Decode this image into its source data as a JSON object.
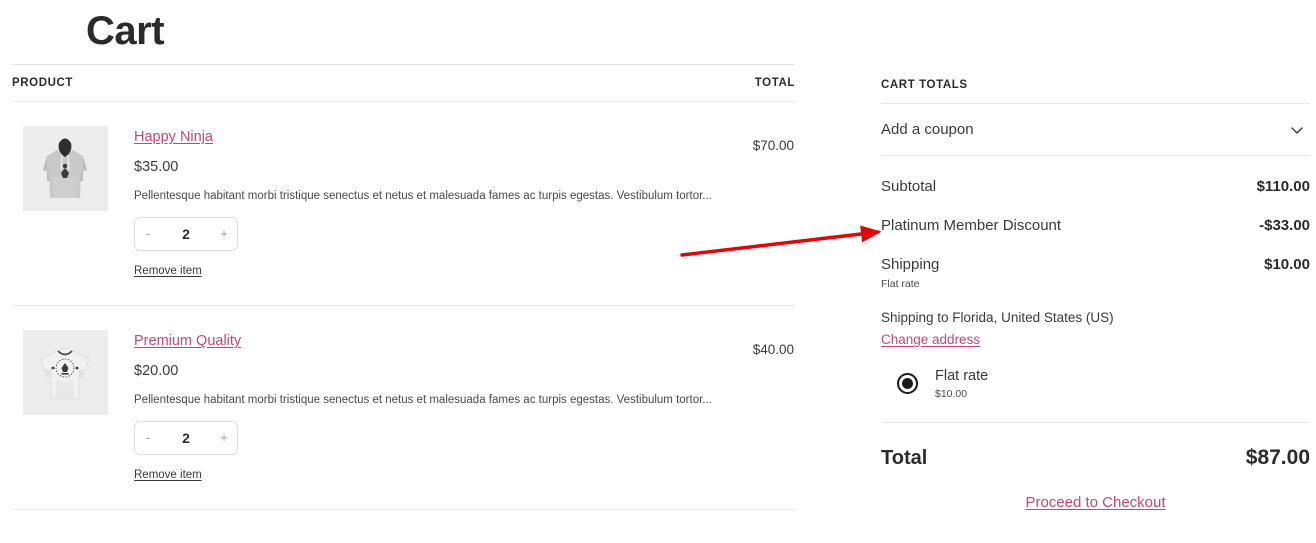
{
  "page": {
    "title": "Cart"
  },
  "table": {
    "headers": {
      "product": "PRODUCT",
      "total": "TOTAL"
    },
    "rows": [
      {
        "name": "Happy Ninja",
        "price": "$35.00",
        "description": "Pellentesque habitant morbi tristique senectus et netus et malesuada fames ac turpis egestas. Vestibulum tortor...",
        "qty": "2",
        "minus": "-",
        "plus": "+",
        "remove_label": "Remove item",
        "line_total": "$70.00",
        "thumb": "hoodie-image"
      },
      {
        "name": "Premium Quality",
        "price": "$20.00",
        "description": "Pellentesque habitant morbi tristique senectus et netus et malesuada fames ac turpis egestas. Vestibulum tortor...",
        "qty": "2",
        "minus": "-",
        "plus": "+",
        "remove_label": "Remove item",
        "line_total": "$40.00",
        "thumb": "tshirt-image"
      }
    ]
  },
  "totals": {
    "heading": "CART TOTALS",
    "coupon_label": "Add a coupon",
    "coupon_chevron": "chevron-down-icon",
    "subtotal_label": "Subtotal",
    "subtotal_value": "$110.00",
    "discount_label": "Platinum Member Discount",
    "discount_value": "-$33.00",
    "shipping_label": "Shipping",
    "shipping_value": "$10.00",
    "shipping_sub": "Flat rate",
    "shipping_to": "Shipping to Florida, United States (US)",
    "change_address_label": "Change address",
    "shipping_method_name": "Flat rate",
    "shipping_method_price": "$10.00",
    "total_label": "Total",
    "total_value": "$87.00",
    "checkout_label": "Proceed to Checkout"
  },
  "colors": {
    "link": "#cc4477",
    "text": "#2b2b2b",
    "border": "#e8e8e8",
    "annotation": "#ee0000",
    "thumb_bg": "#ededed"
  },
  "annotation": {
    "name": "red-arrow-pointing-to-discount"
  }
}
